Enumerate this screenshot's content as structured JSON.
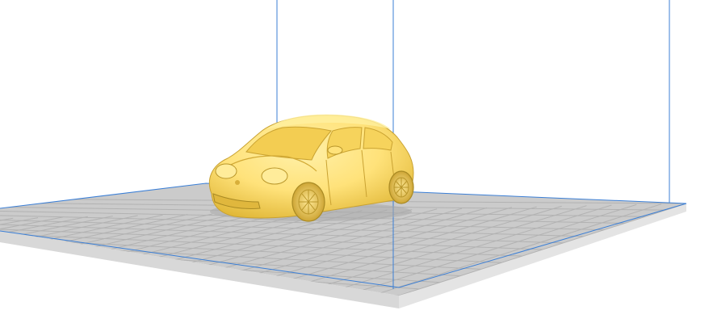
{
  "viewport": {
    "title": "",
    "colors": {
      "background": "#ffffff",
      "plate_top": "#c9c9c9",
      "plate_grid": "#b3b3b3",
      "plate_edge_front": "#dadada",
      "plate_edge_right": "#e6e6e6",
      "volume_lines": "#3b7fd6",
      "model_fill": "#ffe27a",
      "model_shade": "#e8c13f",
      "model_dark": "#b9962a"
    }
  },
  "build_plate": {
    "icon": "build-plate-grid"
  },
  "build_volume": {
    "icon": "build-volume-outline"
  },
  "model": {
    "icon": "car-model",
    "description_visible": false
  }
}
